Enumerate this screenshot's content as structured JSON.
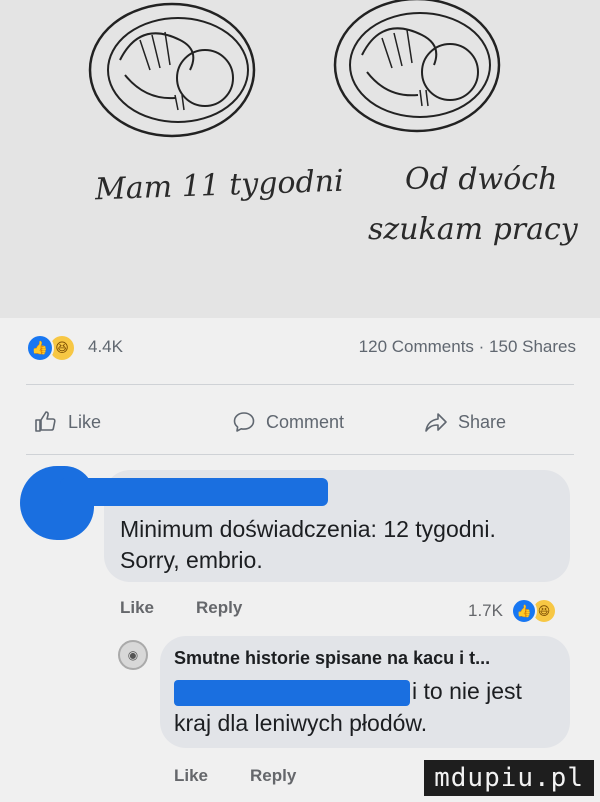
{
  "meme": {
    "caption_left": "Mam 11 tygodni",
    "caption_right_line1": "Od dwóch",
    "caption_right_line2": "szukam pracy"
  },
  "post": {
    "reactions": {
      "icons": [
        "like-icon",
        "haha-icon"
      ],
      "count": "4.4K"
    },
    "comments_shares": "120 Comments · 150 Shares",
    "actions": {
      "like": "Like",
      "comment": "Comment",
      "share": "Share"
    }
  },
  "comments": [
    {
      "text_line1": "Minimum doświadczenia: 12 tygodni.",
      "text_line2": "Sorry, embrio.",
      "like": "Like",
      "reply": "Reply",
      "reaction_count": "1.7K"
    },
    {
      "author": "Smutne historie spisane na kacu i t...",
      "text_line2": "i to nie jest",
      "text_line3": "kraj dla leniwych płodów.",
      "like": "Like",
      "reply": "Reply"
    }
  ],
  "watermark": "mdupiu.pl"
}
